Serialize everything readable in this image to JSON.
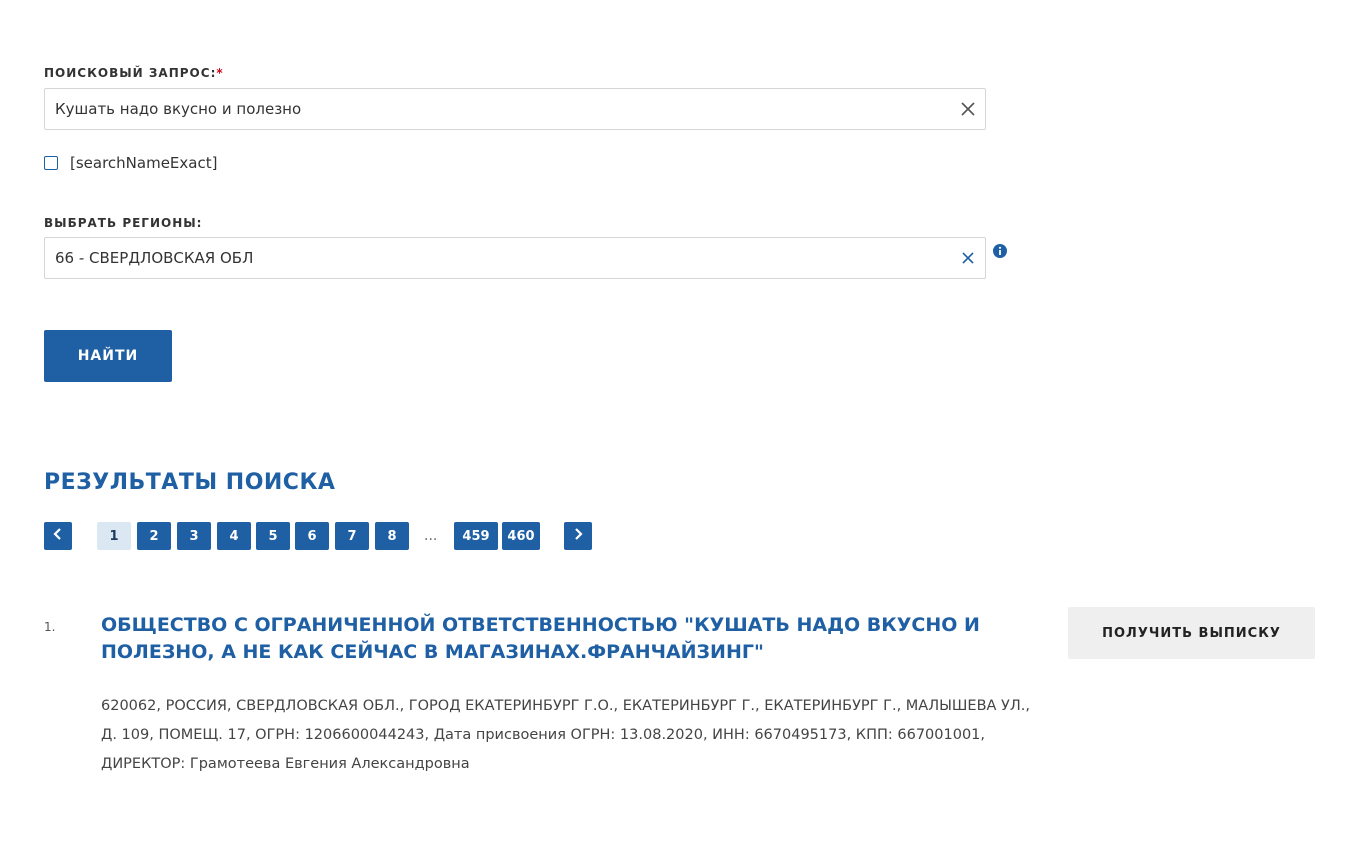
{
  "search": {
    "label": "ПОИСКОВЫЙ ЗАПРОС:",
    "required_mark": "*",
    "value": "Кушать надо вкусно и полезно",
    "clear_icon": "close-icon"
  },
  "exact": {
    "label": "[searchNameExact]",
    "checked": false
  },
  "regions": {
    "label": "ВЫБРАТЬ РЕГИОНЫ:",
    "value": "66 - СВЕРДЛОВСКАЯ ОБЛ",
    "clear_icon": "close-icon",
    "info_icon": "info-icon"
  },
  "find_button": "НАЙТИ",
  "results": {
    "title": "РЕЗУЛЬТАТЫ ПОИСКА",
    "pagination": {
      "prev_icon": "chevron-left-icon",
      "next_icon": "chevron-right-icon",
      "current": "1",
      "pages": [
        "1",
        "2",
        "3",
        "4",
        "5",
        "6",
        "7",
        "8"
      ],
      "ellipsis": "...",
      "last_pages": [
        "459",
        "460"
      ]
    },
    "items": [
      {
        "number": "1.",
        "title": "ОБЩЕСТВО С ОГРАНИЧЕННОЙ ОТВЕТСТВЕННОСТЬЮ \"КУШАТЬ НАДО ВКУСНО И ПОЛЕЗНО, А НЕ КАК СЕЙЧАС В МАГАЗИНАХ.ФРАНЧАЙЗИНГ\"",
        "button": "ПОЛУЧИТЬ ВЫПИСКУ",
        "description": "620062, РОССИЯ, СВЕРДЛОВСКАЯ ОБЛ., ГОРОД ЕКАТЕРИНБУРГ Г.О., ЕКАТЕРИНБУРГ Г., ЕКАТЕРИНБУРГ Г., МАЛЫШЕВА УЛ., Д. 109, ПОМЕЩ. 17, ОГРН: 1206600044243, Дата присвоения ОГРН: 13.08.2020, ИНН: 6670495173, КПП: 667001001, ДИРЕКТОР: Грамотеева Евгения Александровна"
      }
    ]
  },
  "colors": {
    "primary": "#1f5fa4",
    "current_page_bg": "#dbe8f4",
    "required": "#d0021b",
    "secondary_button_bg": "#efefef"
  }
}
